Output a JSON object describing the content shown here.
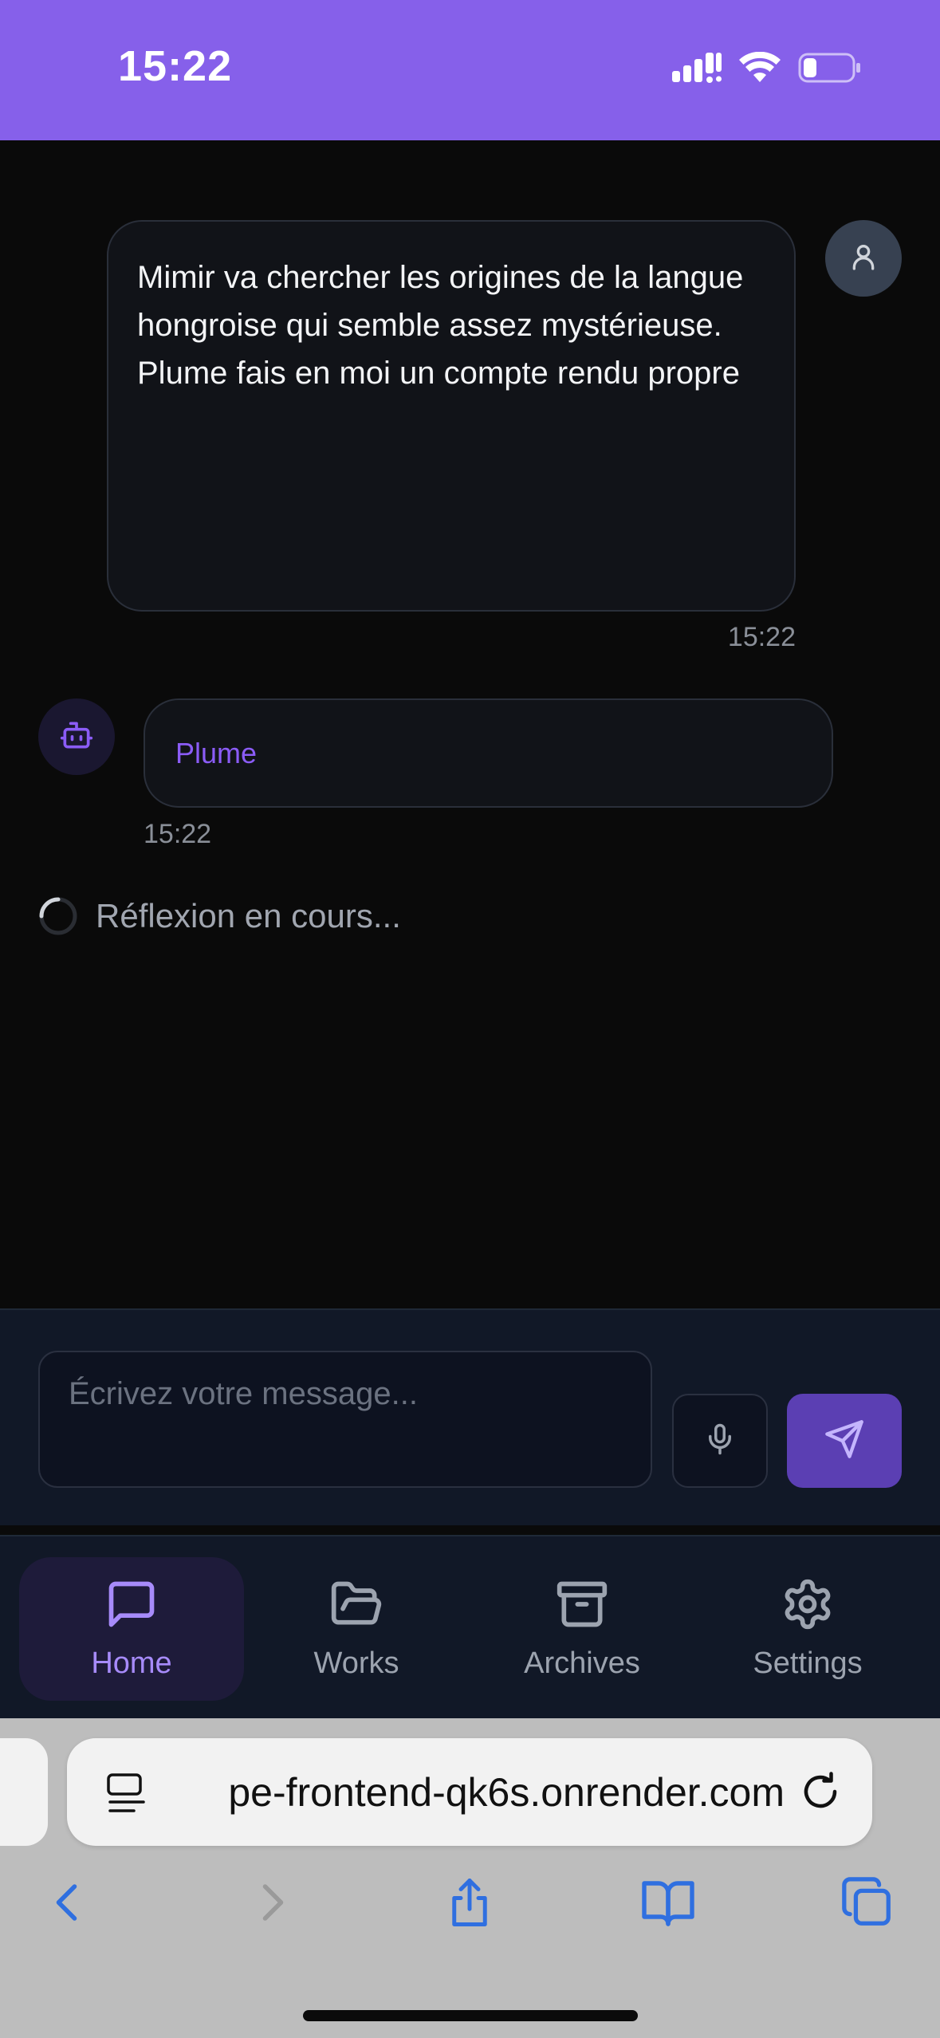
{
  "status_bar": {
    "time": "15:22",
    "background_color": "#8660ea"
  },
  "chat": {
    "user_message": {
      "text": "Mimir va chercher les origines de la langue hongroise qui semble assez mystérieuse. Plume fais en moi un compte rendu propre",
      "time": "15:22",
      "avatar_icon": "user-icon"
    },
    "bot_message": {
      "name": "Plume",
      "time": "15:22",
      "avatar_icon": "bot-icon"
    },
    "thinking_text": "Réflexion en cours..."
  },
  "composer": {
    "placeholder": "Écrivez votre message...",
    "value": "",
    "mic_icon": "microphone-icon",
    "send_icon": "send-icon"
  },
  "nav": {
    "items": [
      {
        "label": "Home",
        "icon": "chat-icon",
        "active": true
      },
      {
        "label": "Works",
        "icon": "folder-icon",
        "active": false
      },
      {
        "label": "Archives",
        "icon": "archive-icon",
        "active": false
      },
      {
        "label": "Settings",
        "icon": "gear-icon",
        "active": false
      }
    ]
  },
  "browser": {
    "url": "pe-frontend-qk6s.onrender.com",
    "toolbar": [
      "back-icon",
      "forward-icon",
      "share-icon",
      "bookmarks-icon",
      "tabs-icon"
    ],
    "accent_color": "#2f6fe0"
  },
  "colors": {
    "accent": "#8b5cf6",
    "surface": "#111827",
    "background": "#0a0a0a"
  }
}
